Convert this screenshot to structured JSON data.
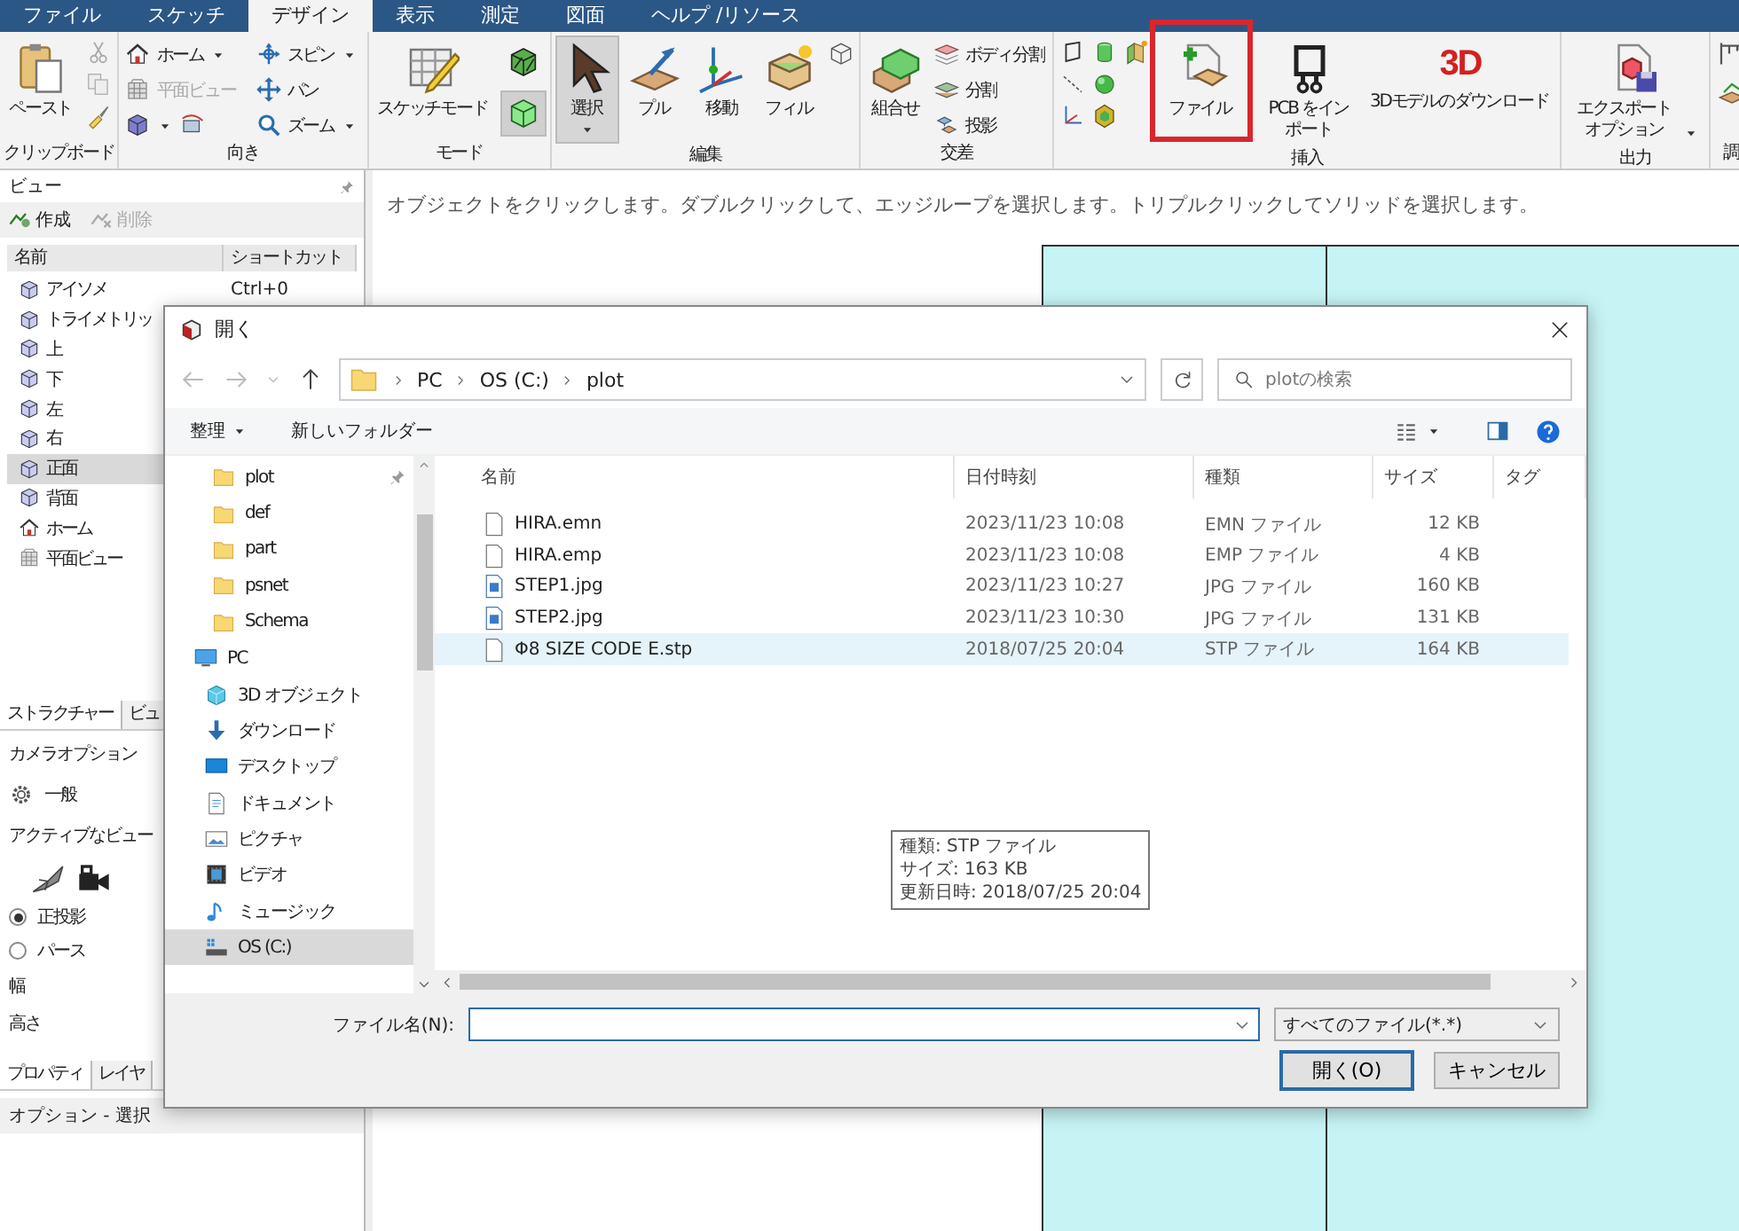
{
  "menu_tabs": [
    {
      "label": "ファイル",
      "selected": false
    },
    {
      "label": "スケッチ",
      "selected": false
    },
    {
      "label": "デザイン",
      "selected": true
    },
    {
      "label": "表示",
      "selected": false
    },
    {
      "label": "測定",
      "selected": false
    },
    {
      "label": "図面",
      "selected": false
    },
    {
      "label": "ヘルプ /リソース",
      "selected": false
    }
  ],
  "ribbon": {
    "clipboard": {
      "label": "クリップボード",
      "paste": "ペースト"
    },
    "orientation": {
      "label": "向き",
      "commands": [
        {
          "label": "ホーム",
          "dropdown": true,
          "disabled": false
        },
        {
          "label": "平面ビュー",
          "dropdown": false,
          "disabled": true
        },
        {
          "label": "スピン",
          "dropdown": true,
          "disabled": false
        },
        {
          "label": "パン",
          "dropdown": false,
          "disabled": false
        },
        {
          "label": "ズーム",
          "dropdown": true,
          "disabled": false
        }
      ]
    },
    "mode": {
      "label": "モード",
      "sketch": "スケッチモード",
      "toggles": [
        {
          "selected": false
        },
        {
          "selected": true
        }
      ]
    },
    "edit": {
      "label": "編集",
      "tools": [
        {
          "label": "選択",
          "selected": true,
          "dropdown": true
        },
        {
          "label": "プル",
          "selected": false,
          "dropdown": false
        },
        {
          "label": "移動",
          "selected": false,
          "dropdown": false
        },
        {
          "label": "フィル",
          "selected": false,
          "dropdown": false
        }
      ]
    },
    "intersect": {
      "label": "交差",
      "combine": "組合せ",
      "commands": [
        "ボディ分割",
        "分割",
        "投影"
      ]
    },
    "insert": {
      "label": "挿入",
      "tools": [
        {
          "label": "ファイル"
        },
        {
          "label": "PCB をインポート"
        },
        {
          "label": "3Dモデルのダウンロード",
          "logo": "3D"
        }
      ]
    },
    "output": {
      "label": "出力",
      "export": "エクスポートオプション",
      "dropdown": true
    },
    "adjust": {
      "label": "調"
    }
  },
  "view_panel": {
    "title": "ビュー",
    "actions": [
      {
        "label": "作成",
        "disabled": false
      },
      {
        "label": "削除",
        "disabled": true
      }
    ],
    "columns": [
      "名前",
      "ショートカット"
    ],
    "rows": [
      {
        "kind": "view",
        "name": "アイソメ",
        "shortcut": "Ctrl+0",
        "selected": false
      },
      {
        "kind": "view",
        "name": "トライメトリッ",
        "selected": false
      },
      {
        "kind": "view",
        "name": "上",
        "selected": false
      },
      {
        "kind": "view",
        "name": "下",
        "selected": false
      },
      {
        "kind": "view",
        "name": "左",
        "selected": false
      },
      {
        "kind": "view",
        "name": "右",
        "selected": false
      },
      {
        "kind": "view",
        "name": "正面",
        "selected": true
      },
      {
        "kind": "view",
        "name": "背面",
        "selected": false
      },
      {
        "kind": "home",
        "name": "ホーム",
        "selected": false
      },
      {
        "kind": "plan",
        "name": "平面ビュー",
        "selected": false
      }
    ]
  },
  "lower_panel": {
    "tabs": [
      {
        "label": "ストラクチャー",
        "selected": true
      },
      {
        "label": "ビュ",
        "selected": false
      }
    ],
    "section": "カメラオプション",
    "group": "一般",
    "viewpoint_label": "アクティブなビュー",
    "projection": [
      {
        "label": "正投影",
        "selected": true
      },
      {
        "label": "パース",
        "selected": false
      }
    ],
    "fields": [
      "幅",
      "高さ"
    ]
  },
  "bottom_panel": {
    "tabs": [
      {
        "label": "プロパティ",
        "selected": true
      },
      {
        "label": "レイヤ",
        "selected": false
      }
    ],
    "header": "オプション - 選択"
  },
  "canvas": {
    "hint": "オブジェクトをクリックします。ダブルクリックして、エッジループを選択します。トリプルクリックしてソリッドを選択します。"
  },
  "dialog": {
    "title": "開く",
    "path": [
      "PC",
      "OS (C:)",
      "plot"
    ],
    "search_placeholder": "plotの検索",
    "toolbar": [
      "整理",
      "新しいフォルダー"
    ],
    "nav": [
      {
        "kind": "folder",
        "label": "plot",
        "pinned": true,
        "selected": false
      },
      {
        "kind": "folder",
        "label": "def",
        "pinned": false,
        "selected": false
      },
      {
        "kind": "folder",
        "label": "part",
        "pinned": false,
        "selected": false
      },
      {
        "kind": "folder",
        "label": "psnet",
        "pinned": false,
        "selected": false
      },
      {
        "kind": "folder",
        "label": "Schema",
        "pinned": false,
        "selected": false
      },
      {
        "kind": "pc",
        "label": "PC",
        "pinned": false,
        "selected": false
      },
      {
        "kind": "objects3d",
        "label": "3D オブジェクト",
        "pinned": false,
        "selected": false
      },
      {
        "kind": "download",
        "label": "ダウンロード",
        "pinned": false,
        "selected": false
      },
      {
        "kind": "desktop",
        "label": "デスクトップ",
        "pinned": false,
        "selected": false
      },
      {
        "kind": "document",
        "label": "ドキュメント",
        "pinned": false,
        "selected": false
      },
      {
        "kind": "picture",
        "label": "ピクチャ",
        "pinned": false,
        "selected": false
      },
      {
        "kind": "video",
        "label": "ビデオ",
        "pinned": false,
        "selected": false
      },
      {
        "kind": "music",
        "label": "ミュージック",
        "pinned": false,
        "selected": false
      },
      {
        "kind": "drive",
        "label": "OS (C:)",
        "pinned": false,
        "selected": true
      }
    ],
    "columns": [
      "名前",
      "日付時刻",
      "種類",
      "サイズ",
      "タグ"
    ],
    "files": [
      {
        "kind": "file",
        "name": "HIRA.emn",
        "date": "2023/11/23 10:08",
        "type": "EMN ファイル",
        "size": "12 KB",
        "selected": false
      },
      {
        "kind": "file",
        "name": "HIRA.emp",
        "date": "2023/11/23 10:08",
        "type": "EMP ファイル",
        "size": "4 KB",
        "selected": false
      },
      {
        "kind": "image",
        "name": "STEP1.jpg",
        "date": "2023/11/23 10:27",
        "type": "JPG ファイル",
        "size": "160 KB",
        "selected": false
      },
      {
        "kind": "image",
        "name": "STEP2.jpg",
        "date": "2023/11/23 10:30",
        "type": "JPG ファイル",
        "size": "131 KB",
        "selected": false
      },
      {
        "kind": "file",
        "name": "Φ8 SIZE CODE E.stp",
        "date": "2018/07/25 20:04",
        "type": "STP ファイル",
        "size": "164 KB",
        "selected": true
      }
    ],
    "tooltip": [
      "種類: STP ファイル",
      "サイズ: 163 KB",
      "更新日時: 2018/07/25 20:04"
    ],
    "filename_label": "ファイル名(N):",
    "filter": "すべてのファイル(*.*)",
    "buttons": [
      "開く(O)",
      "キャンセル"
    ]
  }
}
